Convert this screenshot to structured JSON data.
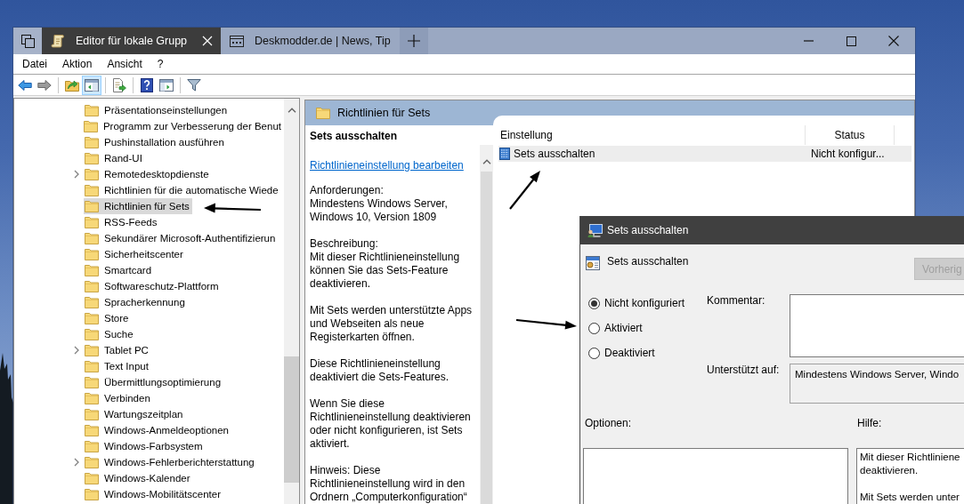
{
  "tabs": [
    {
      "kind": "scroll",
      "title": "Editor für lokale Grupp",
      "selected": true
    },
    {
      "kind": "web",
      "title": "Deskmodder.de | News, Tip",
      "selected": false
    }
  ],
  "menu": [
    "Datei",
    "Aktion",
    "Ansicht",
    "?"
  ],
  "toolbar": [
    {
      "buttons": [
        {
          "kind": "back",
          "disabled": false,
          "pressed": false
        },
        {
          "kind": "forward",
          "disabled": true,
          "pressed": false
        }
      ]
    },
    {
      "buttons": [
        {
          "kind": "up",
          "disabled": false,
          "pressed": false
        },
        {
          "kind": "console-tree",
          "disabled": false,
          "pressed": true
        }
      ]
    },
    {
      "buttons": [
        {
          "kind": "export",
          "disabled": false,
          "pressed": false
        }
      ]
    },
    {
      "buttons": [
        {
          "kind": "help",
          "disabled": false,
          "pressed": false
        },
        {
          "kind": "action-pane",
          "disabled": false,
          "pressed": false
        }
      ]
    },
    {
      "buttons": [
        {
          "kind": "filter",
          "disabled": false,
          "pressed": false
        }
      ]
    }
  ],
  "tree": {
    "items": [
      {
        "label": "Präsentationseinstellungen",
        "has_children": false,
        "selected": false
      },
      {
        "label": "Programm zur Verbesserung der Benut",
        "has_children": false,
        "selected": false
      },
      {
        "label": "Pushinstallation ausführen",
        "has_children": false,
        "selected": false
      },
      {
        "label": "Rand-UI",
        "has_children": false,
        "selected": false
      },
      {
        "label": "Remotedesktopdienste",
        "has_children": true,
        "selected": false
      },
      {
        "label": "Richtlinien für die automatische Wiede",
        "has_children": false,
        "selected": false
      },
      {
        "label": "Richtlinien für Sets",
        "has_children": false,
        "selected": true
      },
      {
        "label": "RSS-Feeds",
        "has_children": false,
        "selected": false
      },
      {
        "label": "Sekundärer Microsoft-Authentifizierun",
        "has_children": false,
        "selected": false
      },
      {
        "label": "Sicherheitscenter",
        "has_children": false,
        "selected": false
      },
      {
        "label": "Smartcard",
        "has_children": false,
        "selected": false
      },
      {
        "label": "Softwareschutz-Plattform",
        "has_children": false,
        "selected": false
      },
      {
        "label": "Spracherkennung",
        "has_children": false,
        "selected": false
      },
      {
        "label": "Store",
        "has_children": false,
        "selected": false
      },
      {
        "label": "Suche",
        "has_children": false,
        "selected": false
      },
      {
        "label": "Tablet PC",
        "has_children": true,
        "selected": false
      },
      {
        "label": "Text Input",
        "has_children": false,
        "selected": false
      },
      {
        "label": "Übermittlungsoptimierung",
        "has_children": false,
        "selected": false
      },
      {
        "label": "Verbinden",
        "has_children": false,
        "selected": false
      },
      {
        "label": "Wartungszeitplan",
        "has_children": false,
        "selected": false
      },
      {
        "label": "Windows-Anmeldeoptionen",
        "has_children": false,
        "selected": false
      },
      {
        "label": "Windows-Farbsystem",
        "has_children": false,
        "selected": false
      },
      {
        "label": "Windows-Fehlerberichterstattung",
        "has_children": true,
        "selected": false
      },
      {
        "label": "Windows-Kalender",
        "has_children": false,
        "selected": false
      },
      {
        "label": "Windows-Mobilitätscenter",
        "has_children": false,
        "selected": false
      }
    ]
  },
  "details": {
    "header": "Richtlinien für Sets",
    "description": {
      "title": "Sets ausschalten",
      "link": "Richtlinieneinstellung bearbeiten",
      "paragraphs": [
        "Anforderungen:\nMindestens Windows Server,\nWindows 10, Version 1809",
        "Beschreibung:\nMit dieser Richtlinieneinstellung\nkönnen Sie das Sets-Feature\ndeaktivieren.",
        "Mit Sets werden unterstützte Apps\nund Webseiten als neue\nRegisterkarten öffnen.",
        "Diese Richtlinieneinstellung\ndeaktiviert die Sets-Features.",
        "Wenn Sie diese\nRichtlinieneinstellung deaktivieren\noder nicht konfigurieren, ist Sets\naktiviert.",
        "Hinweis: Diese\nRichtlinieneinstellung wird in den\nOrdnern „Computerkonfiguration“"
      ]
    },
    "table": {
      "columns": [
        "Einstellung",
        "Status"
      ],
      "rows": [
        {
          "setting": "Sets ausschalten",
          "status": "Nicht konfigur...",
          "selected": true
        }
      ]
    }
  },
  "dialog": {
    "title": "Sets ausschalten",
    "heading": "Sets ausschalten",
    "previous_button": {
      "label": "Vorherig",
      "disabled": true
    },
    "states": [
      {
        "label": "Nicht konfiguriert",
        "selected": true
      },
      {
        "label": "Aktiviert",
        "selected": false
      },
      {
        "label": "Deaktiviert",
        "selected": false
      }
    ],
    "comment_label": "Kommentar:",
    "supported_label": "Unterstützt auf:",
    "supported_value": "Mindestens Windows Server, Windo",
    "options_label": "Optionen:",
    "help_label": "Hilfe:",
    "help_text": "Mit dieser Richtliniene\ndeaktivieren.\n\nMit Sets werden unter"
  }
}
